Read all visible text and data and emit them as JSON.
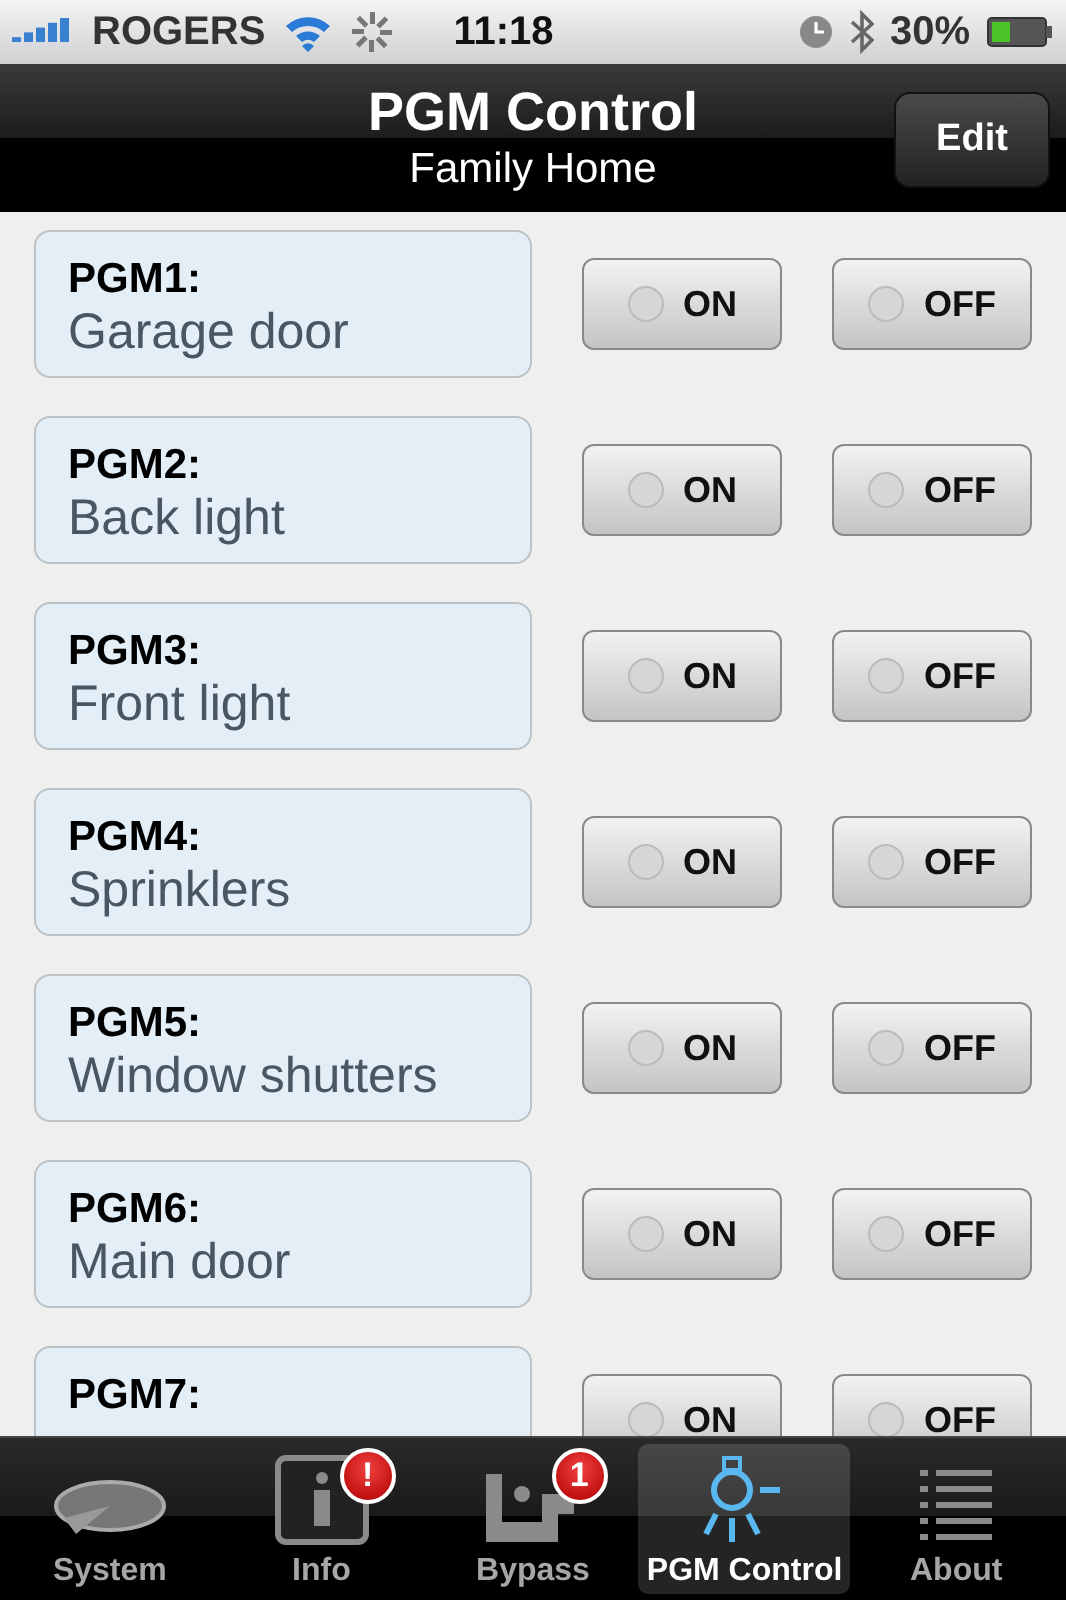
{
  "status_bar": {
    "carrier": "ROGERS",
    "time": "11:18",
    "battery": "30%"
  },
  "nav_bar": {
    "title": "PGM Control",
    "subtitle": "Family Home",
    "edit_button": "Edit"
  },
  "pgms": [
    {
      "number": "PGM1:",
      "name": "Garage door",
      "on_button": {
        "label": "ON",
        "lit": false
      },
      "off_button": {
        "label": "OFF",
        "lit": false
      }
    },
    {
      "number": "PGM2:",
      "name": "Back light",
      "on_button": {
        "label": "ON",
        "lit": false
      },
      "off_button": {
        "label": "OFF",
        "lit": false
      }
    },
    {
      "number": "PGM3:",
      "name": "Front light",
      "on_button": {
        "label": "ON",
        "lit": false
      },
      "off_button": {
        "label": "OFF",
        "lit": false
      }
    },
    {
      "number": "PGM4:",
      "name": "Sprinklers",
      "on_button": {
        "label": "ON",
        "lit": false
      },
      "off_button": {
        "label": "OFF",
        "lit": false
      }
    },
    {
      "number": "PGM5:",
      "name": "Window shutters",
      "on_button": {
        "label": "ON",
        "lit": false
      },
      "off_button": {
        "label": "OFF",
        "lit": false
      }
    },
    {
      "number": "PGM6:",
      "name": "Main door",
      "on_button": {
        "label": "ON",
        "lit": false
      },
      "off_button": {
        "label": "OFF",
        "lit": false
      }
    },
    {
      "number": "PGM7:",
      "on_button": {
        "label": "ON",
        "lit": false
      },
      "off_button": {
        "label": "OFF",
        "lit": false
      }
    }
  ],
  "tab_bar": [
    {
      "kind": "system",
      "label": "System",
      "selected": false
    },
    {
      "kind": "info",
      "label": "Info",
      "selected": false,
      "badge": "!"
    },
    {
      "kind": "bypass",
      "label": "Bypass",
      "selected": false,
      "badge": "1"
    },
    {
      "kind": "pgm",
      "label": "PGM Control",
      "selected": true
    },
    {
      "kind": "about",
      "label": "About",
      "selected": false
    }
  ]
}
